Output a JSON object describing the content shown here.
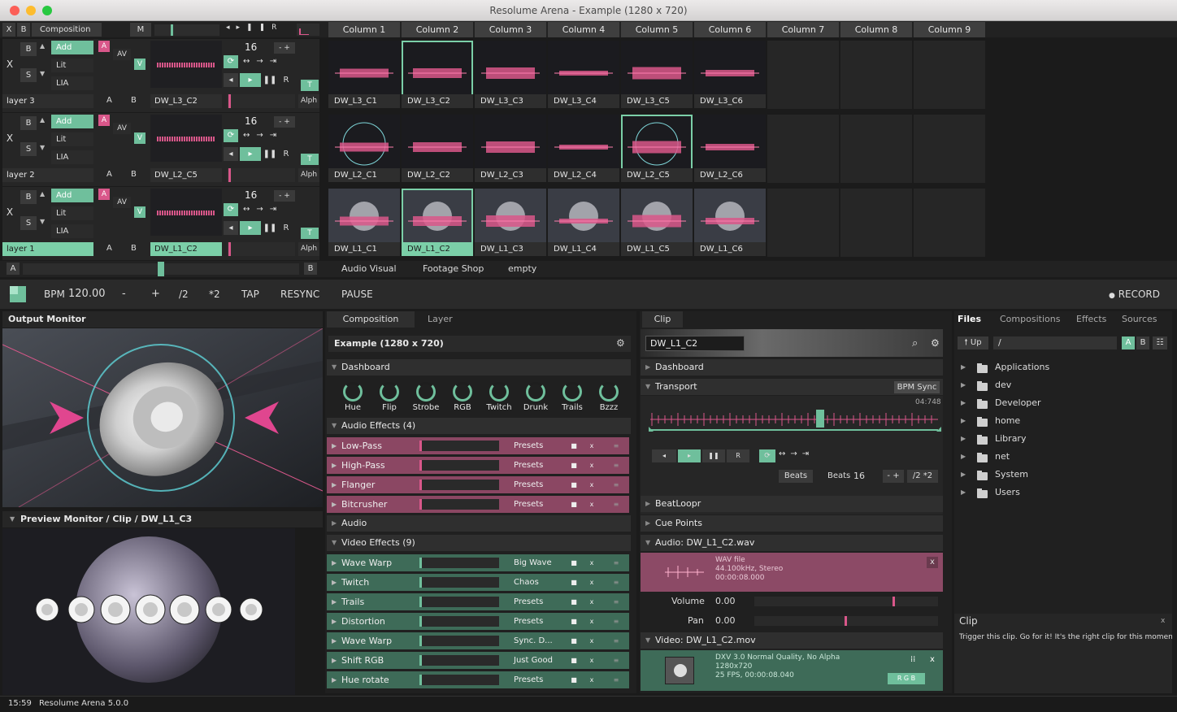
{
  "window": {
    "title": "Resolume Arena - Example (1280 x 720)"
  },
  "topbar": {
    "x": "X",
    "b": "B",
    "composition": "Composition",
    "m": "M"
  },
  "columns": [
    "Column 1",
    "Column 2",
    "Column 3",
    "Column 4",
    "Column 5",
    "Column 6",
    "Column 7",
    "Column 8",
    "Column 9"
  ],
  "layer_controls": {
    "b": "B",
    "s": "S",
    "x": "X",
    "add": "Add",
    "lit": "Lit",
    "lia": "LIA",
    "a": "A",
    "av": "AV",
    "v": "V",
    "t": "T",
    "alph": "Alph",
    "count": "16",
    "plusminus": "- +"
  },
  "layers": [
    {
      "name": "layer 3",
      "current": "DW_L3_C2",
      "clips": [
        "DW_L3_C1",
        "DW_L3_C2",
        "DW_L3_C3",
        "DW_L3_C4",
        "DW_L3_C5",
        "DW_L3_C6"
      ]
    },
    {
      "name": "layer 2",
      "current": "DW_L2_C5",
      "clips": [
        "DW_L2_C1",
        "DW_L2_C2",
        "DW_L2_C3",
        "DW_L2_C4",
        "DW_L2_C5",
        "DW_L2_C6"
      ]
    },
    {
      "name": "layer 1",
      "current": "DW_L1_C2",
      "clips": [
        "DW_L1_C1",
        "DW_L1_C2",
        "DW_L1_C3",
        "DW_L1_C4",
        "DW_L1_C5",
        "DW_L1_C6"
      ]
    }
  ],
  "deck": {
    "a": "A",
    "b": "B",
    "tabs": [
      "Audio Visual",
      "Footage Shop",
      "empty"
    ]
  },
  "tempo": {
    "bpm_label": "BPM",
    "bpm": "120.00",
    "minus": "-",
    "plus": "+",
    "half": "/2",
    "double": "*2",
    "tap": "TAP",
    "resync": "RESYNC",
    "pause": "PAUSE",
    "record": "RECORD"
  },
  "output": {
    "title": "Output Monitor",
    "preview_title": "Preview Monitor / Clip / DW_L1_C3"
  },
  "composition": {
    "tabs": [
      "Composition",
      "Layer"
    ],
    "name": "Example (1280 x 720)",
    "dashboard": "Dashboard",
    "knobs": [
      "Hue",
      "Flip",
      "Strobe",
      "RGB",
      "Twitch",
      "Drunk",
      "Trails",
      "Bzzz"
    ],
    "audio_fx_header": "Audio Effects (4)",
    "audio_fx": [
      {
        "name": "Low-Pass",
        "preset": "Presets"
      },
      {
        "name": "High-Pass",
        "preset": "Presets"
      },
      {
        "name": "Flanger",
        "preset": "Presets"
      },
      {
        "name": "Bitcrusher",
        "preset": "Presets"
      }
    ],
    "audio": "Audio",
    "video_fx_header": "Video Effects (9)",
    "video_fx": [
      {
        "name": "Wave Warp",
        "preset": "Big Wave"
      },
      {
        "name": "Twitch",
        "preset": "Chaos"
      },
      {
        "name": "Trails",
        "preset": "Presets"
      },
      {
        "name": "Distortion",
        "preset": "Presets"
      },
      {
        "name": "Wave Warp",
        "preset": "Sync. D..."
      },
      {
        "name": "Shift RGB",
        "preset": "Just Good"
      },
      {
        "name": "Hue rotate",
        "preset": "Presets"
      }
    ],
    "fx_btn": "x"
  },
  "clip": {
    "tab": "Clip",
    "name": "DW_L1_C2",
    "dashboard": "Dashboard",
    "transport": "Transport",
    "bpm_sync": "BPM Sync",
    "time": "04:748",
    "beats_btn": "Beats",
    "beats_label": "Beats",
    "beats": "16",
    "plusminus": "- +",
    "halfdouble": "/2 *2",
    "beatloopr": "BeatLoopr",
    "cue_points": "Cue Points",
    "audio_header": "Audio: DW_L1_C2.wav",
    "audio_info": [
      "WAV file",
      "44.100kHz, Stereo",
      "00:00:08.000"
    ],
    "volume_label": "Volume",
    "volume": "0.00",
    "pan_label": "Pan",
    "pan": "0.00",
    "video_header": "Video: DW_L1_C2.mov",
    "video_info": [
      "DXV 3.0 Normal Quality, No Alpha",
      "1280x720",
      "25 FPS, 00:00:08.040"
    ],
    "rgb": "R G B"
  },
  "files": {
    "tabs": [
      "Files",
      "Compositions",
      "Effects",
      "Sources"
    ],
    "up": "Up",
    "path": "/",
    "ab": [
      "A",
      "B"
    ],
    "folders": [
      "Applications",
      "dev",
      "Developer",
      "home",
      "Library",
      "net",
      "System",
      "Users"
    ]
  },
  "help": {
    "title": "Clip",
    "text": "Trigger this clip. Go for it! It's the right clip for this moment."
  },
  "status": {
    "time": "15:59",
    "app": "Resolume Arena 5.0.0"
  },
  "colors": {
    "accent_green": "#6fbf9c",
    "accent_pink": "#d9578a"
  }
}
